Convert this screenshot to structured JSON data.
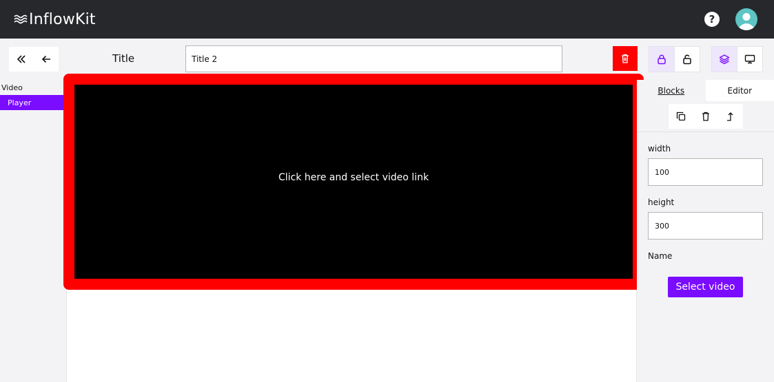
{
  "app": {
    "logo_text": "InflowKit",
    "help_symbol": "?"
  },
  "toolbar": {
    "title_label": "Title",
    "title_value": "Title 2",
    "icons": {
      "collapse": "double-chevron-left-icon",
      "back": "arrow-left-icon",
      "delete": "trash-icon",
      "lock": "lock-icon",
      "unlock": "unlock-icon",
      "layers": "layers-icon",
      "preview": "monitor-icon"
    }
  },
  "tree": {
    "group": "Video",
    "items": [
      {
        "label": "Player",
        "selected": true
      }
    ]
  },
  "canvas": {
    "video_hint": "Click here and select video link"
  },
  "panel": {
    "tabs": [
      {
        "label": "Blocks",
        "selected": true
      },
      {
        "label": "Editor",
        "selected": false
      }
    ],
    "tools": [
      "copy-icon",
      "trash-icon",
      "move-up-icon"
    ],
    "fields": [
      {
        "label": "width",
        "value": "100"
      },
      {
        "label": "height",
        "value": "300"
      }
    ],
    "name_label": "Name",
    "select_button": "Select video"
  },
  "colors": {
    "accent": "#7a0cff",
    "danger": "#ff0000",
    "topbar": "#26282c",
    "avatar": "#5ec4c4"
  }
}
